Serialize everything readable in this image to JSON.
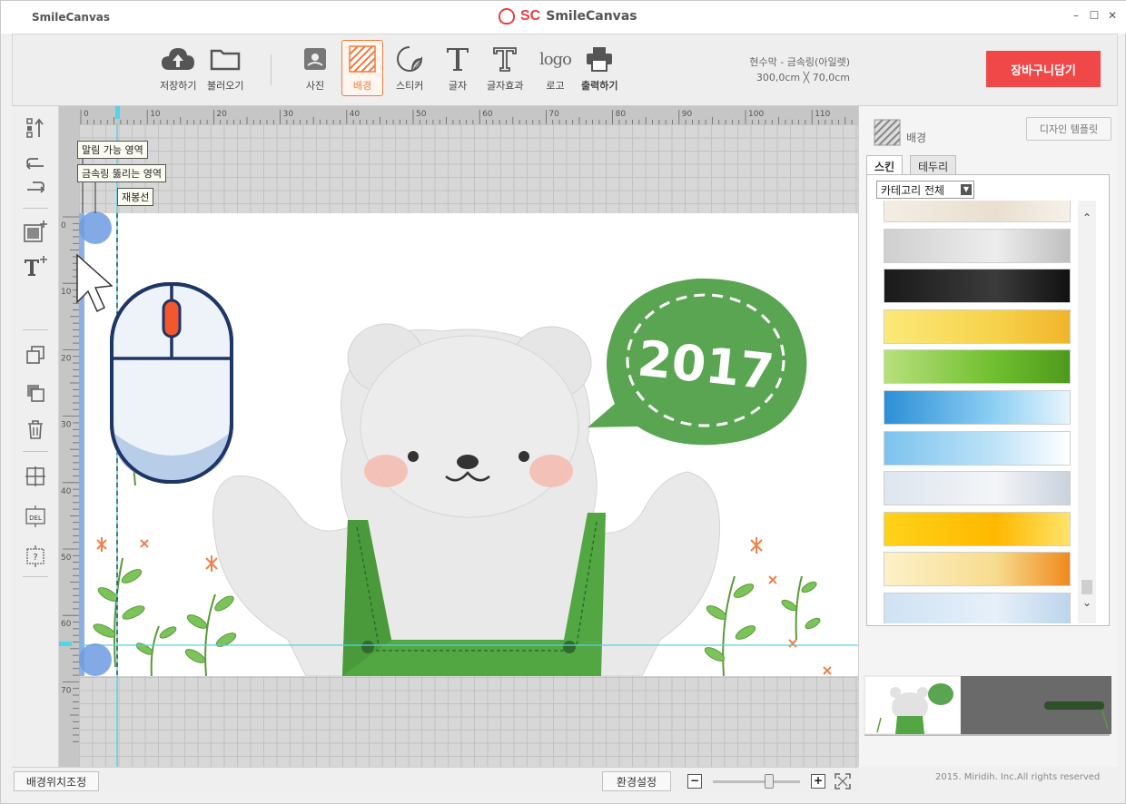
{
  "window": {
    "app_name": "SmileCanvas",
    "logo_sc": "SC",
    "logo_name": "SmileCanvas",
    "minimize": "–",
    "maximize": "☐",
    "close": "✕"
  },
  "toolbar": {
    "save": "저장하기",
    "load": "불러오기",
    "photo": "사진",
    "background": "배경",
    "sticker": "스티커",
    "text": "글자",
    "text_effect": "글자효과",
    "logo": "로고",
    "print": "출력하기",
    "logo_icon_text": "logo",
    "active_tab": "배경"
  },
  "product": {
    "name": "현수막 - 금속링(아일렛)",
    "size": "300,0cm ╳ 70,0cm"
  },
  "cart_button": "장바구니담기",
  "canvas": {
    "ruler_top_labels": [
      "0",
      "10",
      "20",
      "30",
      "40",
      "50",
      "60",
      "70",
      "80",
      "90",
      "100",
      "110"
    ],
    "ruler_left_labels": [
      "0",
      "10",
      "20",
      "30",
      "40",
      "50",
      "60",
      "70"
    ],
    "guide_labels": {
      "fold": "말림 가능 영역",
      "eyelet": "금속링 뚫리는 영역",
      "sewing": "재봉선"
    },
    "bubble_text": "2017"
  },
  "right_panel": {
    "title": "배경",
    "design_template_button": "디자인 템플릿",
    "tabs": [
      "스킨",
      "테두리"
    ],
    "active_tab": "스킨",
    "category": "카테고리 전체",
    "scroll_up": "⌃",
    "scroll_down": "⌄",
    "skins": [
      {
        "name": "skin-ivory",
        "colors": [
          "#f3ede3",
          "#e9dfcf",
          "#f6f1e8"
        ]
      },
      {
        "name": "skin-silver-lights",
        "colors": [
          "#cfcfcf",
          "#ededed",
          "#bfbfbf"
        ]
      },
      {
        "name": "skin-black",
        "colors": [
          "#1a1a1a",
          "#3b3b3b",
          "#111111"
        ]
      },
      {
        "name": "skin-yellow-floral",
        "colors": [
          "#fbe979",
          "#f6d24a",
          "#f0b52a"
        ]
      },
      {
        "name": "skin-green-grass",
        "colors": [
          "#b8e07c",
          "#6fbe2e",
          "#4f9a1c"
        ]
      },
      {
        "name": "skin-blue-sky-clouds",
        "colors": [
          "#2b8fd6",
          "#8fd0f3",
          "#e8f5fd"
        ]
      },
      {
        "name": "skin-light-blue",
        "colors": [
          "#7cc3ee",
          "#bfe3f8",
          "#ffffff"
        ]
      },
      {
        "name": "skin-pale-mist",
        "colors": [
          "#dde5ee",
          "#f3f5f8",
          "#c9d2dd"
        ]
      },
      {
        "name": "skin-sunburst",
        "colors": [
          "#ffd21a",
          "#ffb800",
          "#ffe36a"
        ]
      },
      {
        "name": "skin-cream-orange",
        "colors": [
          "#fdf1c8",
          "#f7dc8e",
          "#f08a1e"
        ]
      },
      {
        "name": "skin-pale-blue",
        "colors": [
          "#cfe2f3",
          "#e6f0fa",
          "#bcd5ec"
        ]
      }
    ],
    "copyright": "2015. Miridih. Inc.All rights reserved"
  },
  "bottom": {
    "bg_position_button": "배경위치조정",
    "settings_button": "환경설정",
    "zoom_minus": "−",
    "zoom_plus": "+",
    "zoom_level": 0.6
  },
  "left_tools": {
    "delete_icon_text": "DEL",
    "help_icon_text": "?"
  },
  "colors": {
    "accent": "#f07b3f",
    "cart": "#f04848",
    "bubble": "#5aa552",
    "overalls": "#52a743",
    "guide": "#4fd6e8"
  }
}
